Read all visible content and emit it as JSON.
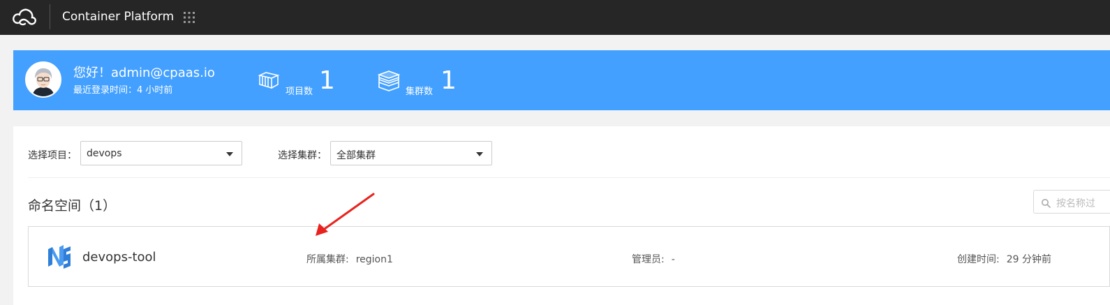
{
  "topbar": {
    "logo_icon": "cloud-logo-icon",
    "title": "Container Platform",
    "apps_icon": "grid-apps-icon"
  },
  "banner": {
    "greeting": "您好！admin@cpaas.io",
    "last_login": "最近登录时间：4 小时前",
    "stats": {
      "projects": {
        "label": "项目数",
        "value": "1",
        "icon": "projects-icon"
      },
      "clusters": {
        "label": "集群数",
        "value": "1",
        "icon": "clusters-icon"
      }
    },
    "colors": {
      "background": "#43a0ff"
    }
  },
  "filters": {
    "project": {
      "label": "选择项目：",
      "value": "devops"
    },
    "cluster": {
      "label": "选择集群：",
      "value": "全部集群"
    }
  },
  "namespaces": {
    "title": "命名空间（1）",
    "search_placeholder": "按名称过",
    "items": [
      {
        "name": "devops-tool",
        "cluster_label": "所属集群:",
        "cluster_value": "region1",
        "admin_label": "管理员:",
        "admin_value": "-",
        "created_label": "创建时间:",
        "created_value": "29 分钟前"
      }
    ]
  },
  "annotation": {
    "arrow_color": "#e8231f"
  }
}
